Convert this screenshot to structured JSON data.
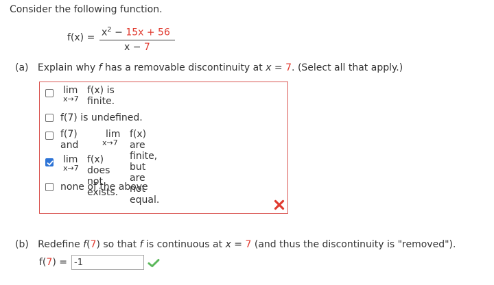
{
  "intro": "Consider the following function.",
  "function": {
    "lhs": "f(x) =",
    "numerator_x": "x",
    "numerator_exp": "2",
    "numerator_minus": " − ",
    "numerator_rest": "15x + 56",
    "denominator_x": "x − ",
    "denominator_c": "7"
  },
  "part_a": {
    "label": "(a)",
    "prompt_1": "Explain why ",
    "prompt_f": "f",
    "prompt_2": " has a removable discontinuity at ",
    "prompt_x": "x",
    "prompt_eq": " = ",
    "prompt_val": "7",
    "prompt_3": ". (Select all that apply.)",
    "options": [
      {
        "lim": "lim",
        "sub": "x→7",
        "fx": "f(x)",
        "text": " is finite.",
        "checked": false
      },
      {
        "text": "f(7) is undefined.",
        "checked": false
      },
      {
        "pre": "f(7) and ",
        "lim": "lim",
        "sub": "x→7",
        "fx": "f(x)",
        "text": " are finite, but are not equal.",
        "checked": false
      },
      {
        "lim": "lim",
        "sub": "x→7",
        "fx": "f(x)",
        "text": " does not exists.",
        "checked": true
      },
      {
        "text": "none of the above",
        "checked": false
      }
    ],
    "result_icon": "incorrect-x-icon",
    "result_color": "#e03a2f"
  },
  "part_b": {
    "label": "(b)",
    "prompt_1": "Redefine ",
    "prompt_f": "f",
    "prompt_paren_open": "(",
    "prompt_val1": "7",
    "prompt_paren_close": ")",
    "prompt_2": " so that ",
    "prompt_f2": "f",
    "prompt_3": " is continuous at ",
    "prompt_x": "x",
    "prompt_eq": " = ",
    "prompt_val2": "7",
    "prompt_4": " (and thus the discontinuity is \"removed\").",
    "f_label": "f(",
    "f_val": "7",
    "f_label_close": ") =",
    "input_value": "-1",
    "result_icon": "correct-check-icon",
    "result_color": "#5cb85c"
  }
}
